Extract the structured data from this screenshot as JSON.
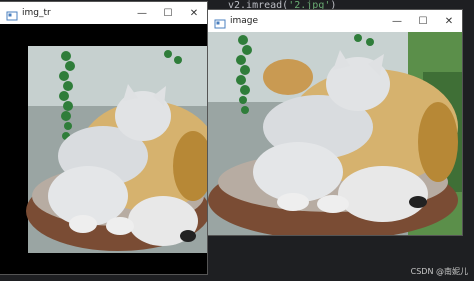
{
  "background": {
    "code_prefix": "v2.imread(",
    "code_string": "'2.jpg'",
    "code_suffix": ")"
  },
  "watermark": "CSDN @南妮儿",
  "windows": [
    {
      "title": "img_tr",
      "minimize": "—",
      "maximize": "☐",
      "close": "✕"
    },
    {
      "title": "image",
      "minimize": "—",
      "maximize": "☐",
      "close": "✕"
    }
  ],
  "colors": {
    "titlebar": "#ffffff",
    "window_bg": "#000000",
    "code_bg": "#1e1f22"
  }
}
